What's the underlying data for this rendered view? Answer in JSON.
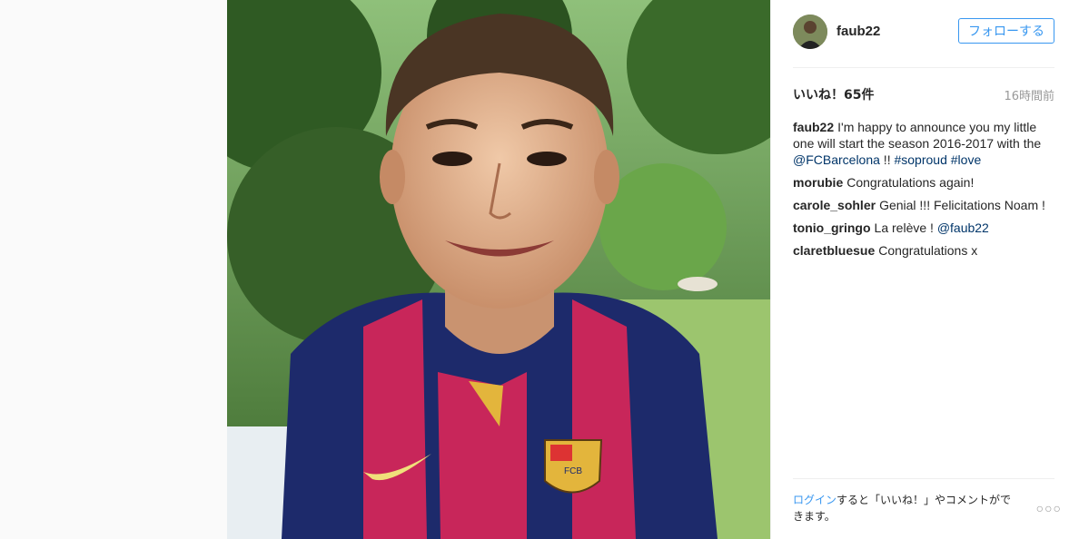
{
  "post": {
    "username": "faub22",
    "follow_label": "フォローする",
    "likes": "いいね！65件",
    "time": "16時間前",
    "caption": {
      "user": "faub22",
      "text": "I'm happy to announce you my little one will start the season 2016-2017 with the",
      "mention": "@FCBarcelona",
      "after": " !! ",
      "tag1": "#soproud",
      "tag2": "#love"
    },
    "comments": [
      {
        "user": "morubie",
        "text": "Congratulations again!"
      },
      {
        "user": "carole_sohler",
        "text": "Genial !!! Felicitations Noam !"
      },
      {
        "user": "tonio_gringo",
        "text": "La relève ! ",
        "mention": "@faub22"
      },
      {
        "user": "claretbluesue",
        "text": "Congratulations x"
      }
    ],
    "login_link": "ログイン",
    "login_rest": "すると「いいね！」やコメントができます。",
    "more": "○○○"
  },
  "photo": {
    "description_icon": "photo-image",
    "shirt_badge": "FCB"
  }
}
